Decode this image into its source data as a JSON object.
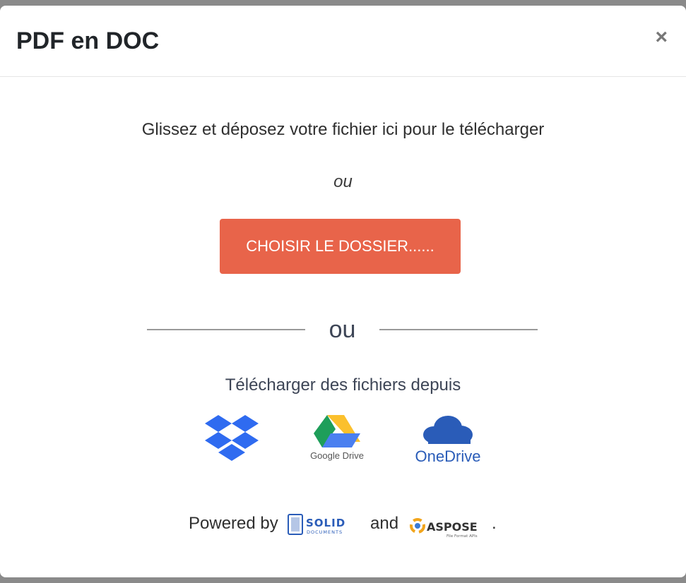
{
  "modal": {
    "title": "PDF en DOC",
    "close_symbol": "×"
  },
  "upload": {
    "drop_text": "Glissez et déposez votre fichier ici pour le télécharger",
    "or_italic": "ou",
    "choose_button": "CHOISIR LE DOSSIER......",
    "divider_text": "ou",
    "upload_from_text": "Télécharger des fichiers depuis"
  },
  "cloud_sources": {
    "dropbox_icon": "dropbox-icon",
    "google_drive_label": "Google Drive",
    "onedrive_label": "OneDrive"
  },
  "powered": {
    "prefix": "Powered by",
    "solid_logo_text": "SOLID",
    "solid_logo_subtext": "DOCUMENTS",
    "conjunction": "and",
    "aspose_logo_text": "ASPOSE",
    "aspose_logo_subtext": "File Format APIs",
    "suffix": "."
  },
  "colors": {
    "accent": "#e8644a",
    "dropbox": "#2f6bf0",
    "onedrive": "#2a5cb8"
  }
}
